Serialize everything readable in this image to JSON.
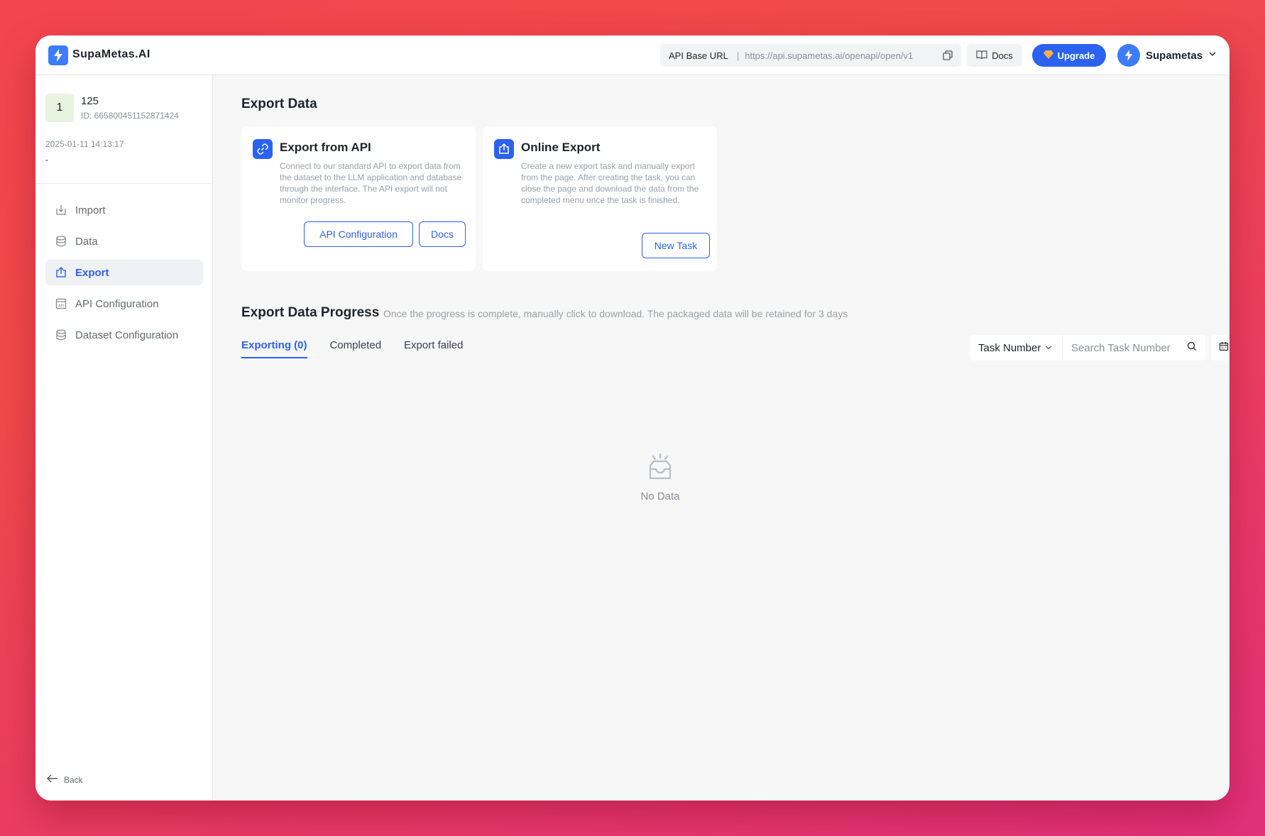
{
  "app": {
    "name": "SupaMetas.AI"
  },
  "topbar": {
    "api_base_label": "API Base URL",
    "api_base_sep": "|",
    "api_base_url": "https://api.supametas.ai/openapi/open/v1",
    "docs_label": "Docs",
    "upgrade_label": "Upgrade",
    "user_name": "Supametas"
  },
  "dataset": {
    "badge": "1",
    "name": "125",
    "id": "ID: 665800451152871424",
    "created": "2025-01-11 14:13:17",
    "description": "-"
  },
  "sidebar": {
    "items": [
      {
        "label": "Import",
        "icon": "import-icon",
        "active": false
      },
      {
        "label": "Data",
        "icon": "database-icon",
        "active": false
      },
      {
        "label": "Export",
        "icon": "export-icon",
        "active": true
      },
      {
        "label": "API Configuration",
        "icon": "api-icon",
        "active": false
      },
      {
        "label": "Dataset Configuration",
        "icon": "database-icon",
        "active": false
      }
    ],
    "back_label": "Back"
  },
  "main": {
    "title": "Export Data",
    "cards": {
      "api": {
        "title": "Export from API",
        "description": "Connect to our standard API to export data from the dataset to the LLM application and database through the interface. The API export will not monitor progress.",
        "primary_button": "API Configuration",
        "secondary_button": "Docs"
      },
      "online": {
        "title": "Online Export",
        "description": "Create a new export task and manually export from the page. After creating the task, you can close the page and download the data from the completed menu once the task is finished.",
        "button": "New Task"
      }
    },
    "progress": {
      "title": "Export Data Progress",
      "subtitle": "Once the progress is complete, manually click to download. The packaged data will be retained for 3 days",
      "tabs": [
        "Exporting (0)",
        "Completed",
        "Export failed"
      ],
      "active_tab": 0,
      "filter_select": "Task Number",
      "search_placeholder": "Search Task Number",
      "empty_text": "No Data"
    }
  },
  "colors": {
    "accent": "#2b62f0",
    "logo": "#3d7bff"
  }
}
